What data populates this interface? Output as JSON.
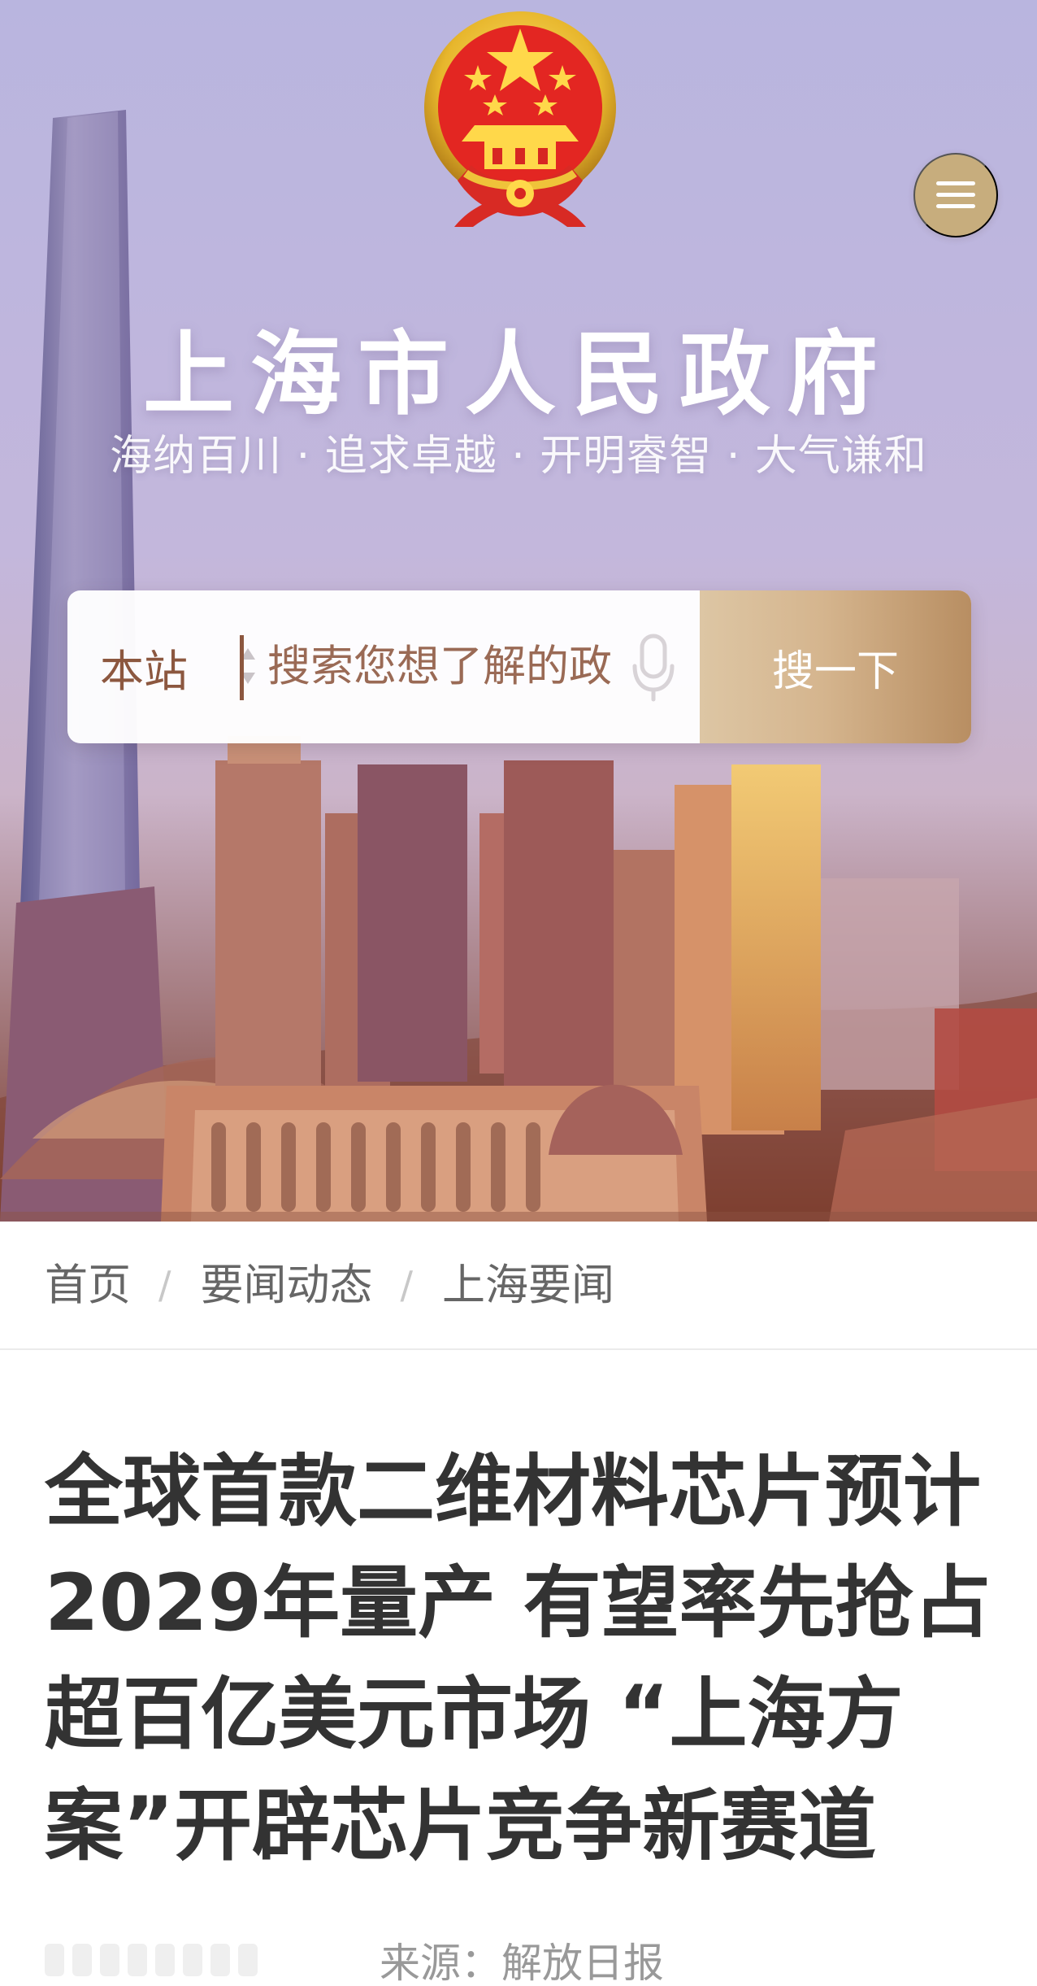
{
  "hero": {
    "site_title": "上海市人民政府",
    "slogan": "海纳百川 · 追求卓越 · 开明睿智 · 大气谦和",
    "emblem_icon": "national-emblem-icon",
    "menu_icon": "hamburger-menu-icon"
  },
  "search": {
    "scope_label": "本站",
    "placeholder": "搜索您想了解的政",
    "mic_icon": "microphone-icon",
    "button_label": "搜一下"
  },
  "breadcrumb": {
    "items": [
      {
        "label": "首页"
      },
      {
        "label": "要闻动态"
      },
      {
        "label": "上海要闻"
      }
    ],
    "separator": "/"
  },
  "article": {
    "title": "全球首款二维材料芯片预计2029年量产 有望率先抢占超百亿美元市场 “上海方案”开辟芯片竞争新赛道",
    "source_label": "来源：",
    "source": "解放日报"
  },
  "colors": {
    "accent": "#c7ad7d",
    "search_text": "#8c573f",
    "title_text": "#333333"
  }
}
